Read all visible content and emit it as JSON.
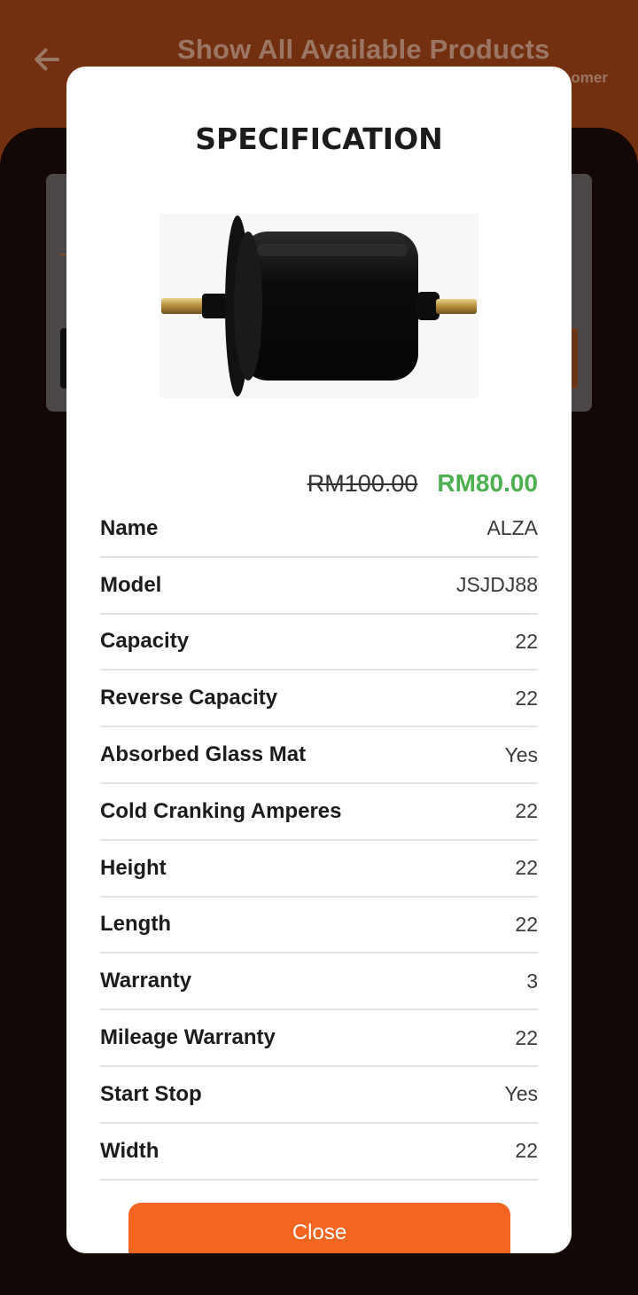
{
  "background": {
    "header_title": "Show All Available Products",
    "header_subtitle_partial": "omer"
  },
  "modal": {
    "title": "SPECIFICATION",
    "price": {
      "original": "RM100.00",
      "discounted": "RM80.00",
      "discount_color": "#4caf50"
    },
    "specs": [
      {
        "label": "Name",
        "value": "ALZA"
      },
      {
        "label": "Model",
        "value": "JSJDJ88"
      },
      {
        "label": "Capacity",
        "value": "22"
      },
      {
        "label": "Reverse Capacity",
        "value": "22"
      },
      {
        "label": "Absorbed Glass Mat",
        "value": "Yes"
      },
      {
        "label": "Cold Cranking Amperes",
        "value": "22"
      },
      {
        "label": "Height",
        "value": "22"
      },
      {
        "label": "Length",
        "value": "22"
      },
      {
        "label": "Warranty",
        "value": "3"
      },
      {
        "label": "Mileage Warranty",
        "value": "22"
      },
      {
        "label": "Start Stop",
        "value": "Yes"
      },
      {
        "label": "Width",
        "value": "22"
      }
    ],
    "close_label": "Close"
  },
  "colors": {
    "accent": "#f26622",
    "header_bg": "#733011"
  },
  "icons": {
    "back": "arrow-left-icon"
  }
}
